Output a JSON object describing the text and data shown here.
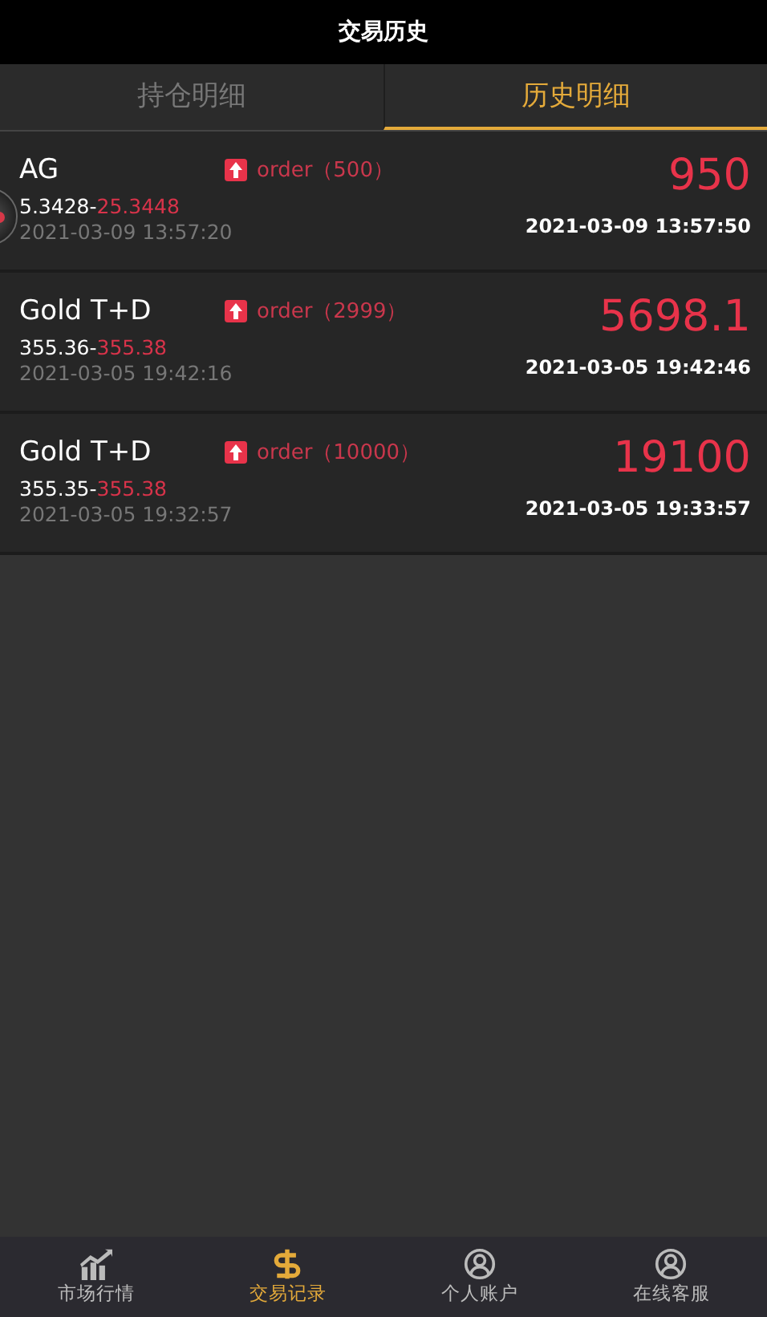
{
  "header": {
    "title": "交易历史"
  },
  "tabs": [
    {
      "label": "持仓明细",
      "selected": false
    },
    {
      "label": "历史明细",
      "selected": true
    }
  ],
  "orders": [
    {
      "name": "AG",
      "order": "order（500）",
      "open_price": "5.3428",
      "close_price": "25.3448",
      "open_time": "2021-03-09 13:57:20",
      "amount": "950",
      "close_time": "2021-03-09 13:57:50"
    },
    {
      "name": "Gold T+D",
      "order": "order（2999）",
      "open_price": "355.36",
      "close_price": "355.38",
      "open_time": "2021-03-05 19:42:16",
      "amount": "5698.1",
      "close_time": "2021-03-05 19:42:46"
    },
    {
      "name": "Gold T+D",
      "order": "order（10000）",
      "open_price": "355.35",
      "close_price": "355.38",
      "open_time": "2021-03-05 19:32:57",
      "amount": "19100",
      "close_time": "2021-03-05 19:33:57"
    }
  ],
  "price_separator": "-",
  "nav": [
    {
      "label": "市场行情",
      "selected": false
    },
    {
      "label": "交易记录",
      "selected": true
    },
    {
      "label": "个人账户",
      "selected": false
    },
    {
      "label": "在线客服",
      "selected": false
    }
  ]
}
